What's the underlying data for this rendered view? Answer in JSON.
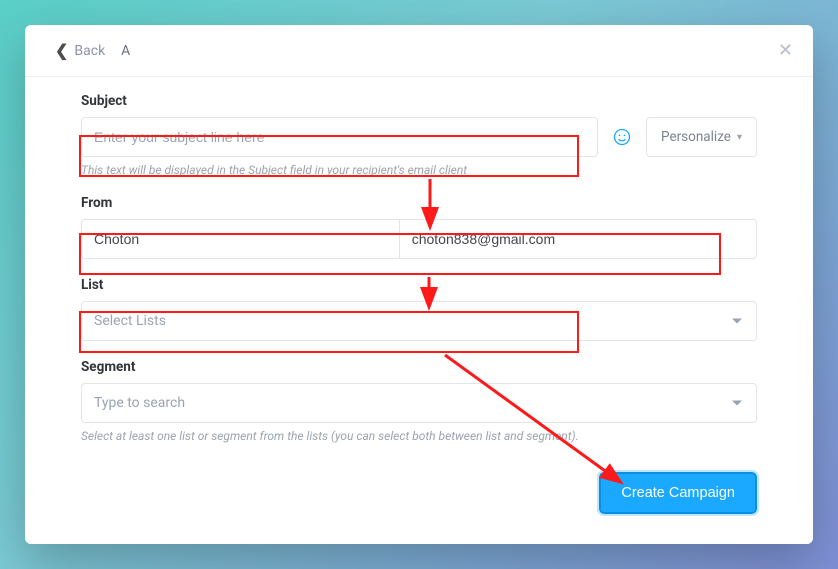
{
  "header": {
    "back_label": "Back",
    "breadcrumb": "A"
  },
  "subject": {
    "label": "Subject",
    "placeholder": "Enter your subject line here",
    "help": "This text will be displayed in the Subject field in your recipient's email client",
    "personalize_label": "Personalize"
  },
  "from": {
    "label": "From",
    "name_value": "Choton",
    "email_value": "choton838@gmail.com"
  },
  "list": {
    "label": "List",
    "placeholder": "Select Lists"
  },
  "segment": {
    "label": "Segment",
    "placeholder": "Type to search",
    "help": "Select at least one list or segment from the lists (you can select both between list and segment)."
  },
  "footer": {
    "create_label": "Create Campaign"
  }
}
